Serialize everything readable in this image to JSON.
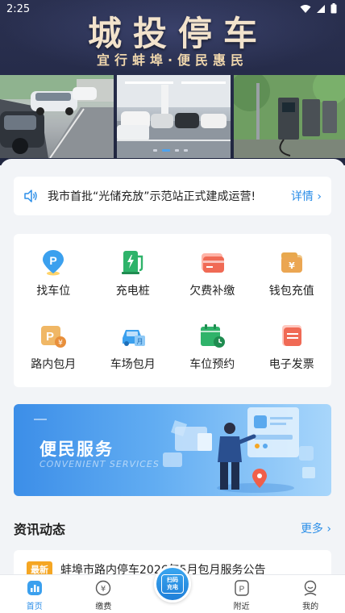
{
  "status_bar": {
    "time": "2:25"
  },
  "banner": {
    "title": "城投停车",
    "subtitle": "宜行蚌埠·便民惠民",
    "slides_total": 4,
    "active_slide": 2
  },
  "notice": {
    "text": "我市首批“光储充放”示范站正式建成运营!",
    "more": "详情 ›"
  },
  "services": [
    {
      "label": "找车位",
      "icon": "parking-pin-icon"
    },
    {
      "label": "充电桩",
      "icon": "charging-pile-icon"
    },
    {
      "label": "欠费补缴",
      "icon": "card-payment-icon"
    },
    {
      "label": "钱包充值",
      "icon": "wallet-icon"
    },
    {
      "label": "路内包月",
      "icon": "street-monthly-icon"
    },
    {
      "label": "车场包月",
      "icon": "lot-monthly-icon"
    },
    {
      "label": "车位预约",
      "icon": "calendar-icon"
    },
    {
      "label": "电子发票",
      "icon": "invoice-icon"
    }
  ],
  "service_banner": {
    "title": "便民服务",
    "subtitle": "CONVENIENT SERVICES"
  },
  "news": {
    "title": "资讯动态",
    "more": "更多 ›",
    "items": [
      {
        "badge": "最新",
        "text": "蚌埠市路内停车2026年5月包月服务公告"
      }
    ]
  },
  "tabbar": {
    "items": [
      {
        "label": "首页",
        "icon": "home-icon",
        "active": true
      },
      {
        "label": "缴费",
        "icon": "yuan-coin-icon",
        "active": false
      },
      {
        "label": "",
        "icon": "scan-charge-icon",
        "active": false
      },
      {
        "label": "附近",
        "icon": "parking-nearby-icon",
        "active": false
      },
      {
        "label": "我的",
        "icon": "user-icon",
        "active": false
      }
    ],
    "scan_label_line1": "扫码",
    "scan_label_line2": "充电"
  },
  "colors": {
    "accent": "#2b8ee8",
    "banner_bg": "#262c4a",
    "title_gold": "#f3e3cc",
    "badge": "#f5a623"
  }
}
